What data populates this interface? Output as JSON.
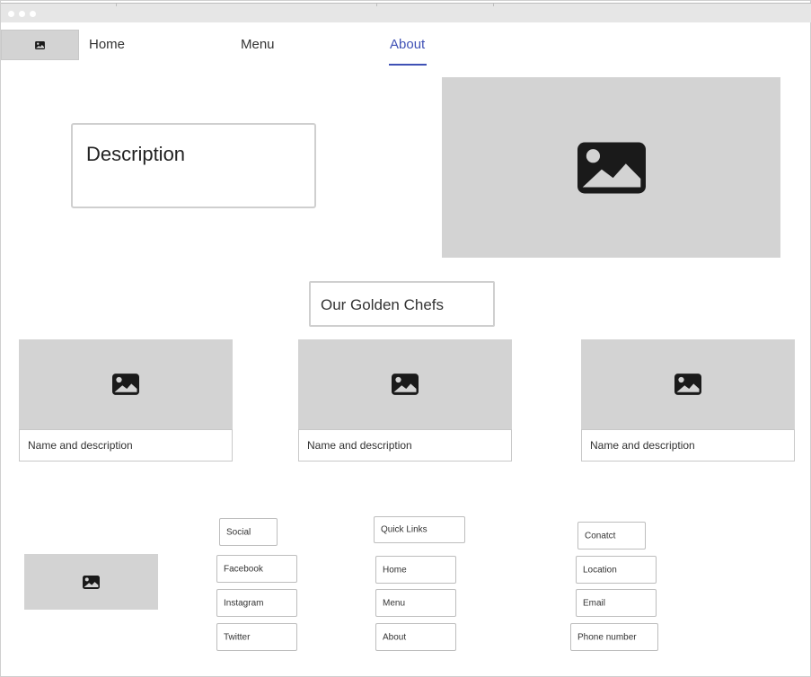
{
  "nav": {
    "logo_icon": "image-icon",
    "links": [
      {
        "label": "Home",
        "active": false
      },
      {
        "label": "Menu",
        "active": false
      },
      {
        "label": "About",
        "active": true
      }
    ],
    "accent_color": "#3f51b5"
  },
  "hero": {
    "description_label": "Description",
    "image_icon": "image-icon"
  },
  "chefs": {
    "title": "Our Golden Chefs",
    "cards": [
      {
        "label": "Name and description",
        "icon": "image-icon"
      },
      {
        "label": "Name and description",
        "icon": "image-icon"
      },
      {
        "label": "Name and description",
        "icon": "image-icon"
      }
    ]
  },
  "footer": {
    "logo_icon": "image-icon",
    "social": {
      "heading": "Social",
      "items": [
        "Facebook",
        "Instagram",
        "Twitter"
      ]
    },
    "quick_links": {
      "heading": "Quick Links",
      "items": [
        "Home",
        "Menu",
        "About"
      ]
    },
    "contact": {
      "heading": "Conatct",
      "items": [
        "Location",
        "Email",
        "Phone number"
      ]
    }
  },
  "colors": {
    "placeholder_gray": "#d3d3d3",
    "border_gray": "#cfcfcf",
    "icon_dark": "#1a1a1a"
  }
}
